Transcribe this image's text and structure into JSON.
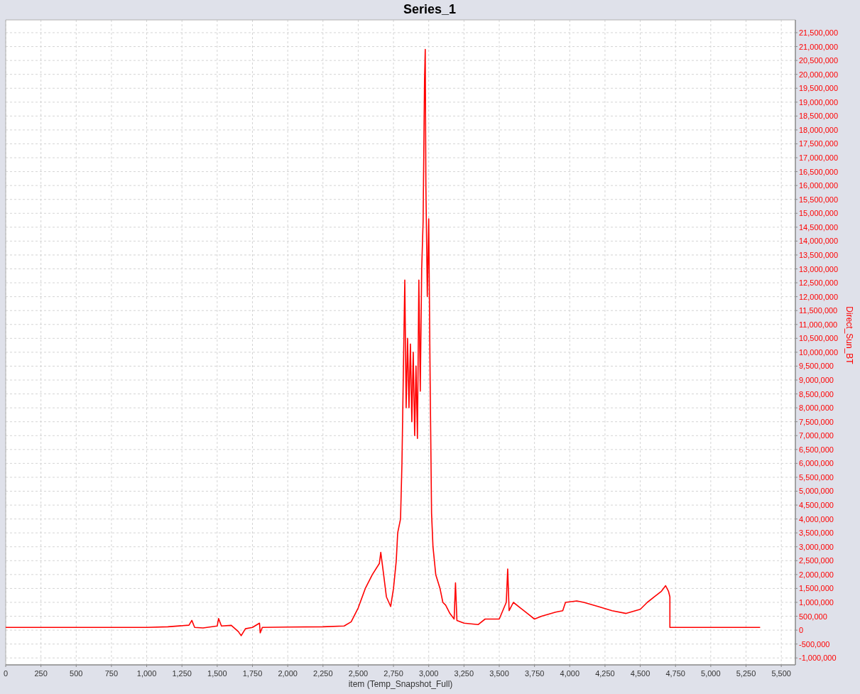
{
  "chart": {
    "chart_data": {
      "type": "line",
      "title": "Series_1",
      "xlabel": "item (Temp_Snapshot_Full)",
      "ylabel": "Direct_Sun_BT",
      "x": [
        0,
        500,
        1000,
        1150,
        1300,
        1320,
        1340,
        1400,
        1500,
        1510,
        1530,
        1600,
        1650,
        1670,
        1700,
        1750,
        1800,
        1805,
        1820,
        2000,
        2250,
        2400,
        2450,
        2500,
        2550,
        2600,
        2650,
        2660,
        2680,
        2700,
        2730,
        2750,
        2770,
        2780,
        2800,
        2810,
        2830,
        2840,
        2850,
        2860,
        2870,
        2880,
        2890,
        2900,
        2910,
        2920,
        2930,
        2940,
        2950,
        2960,
        2970,
        2975,
        2980,
        2990,
        3000,
        3010,
        3020,
        3030,
        3050,
        3080,
        3100,
        3120,
        3150,
        3180,
        3190,
        3200,
        3250,
        3350,
        3400,
        3500,
        3550,
        3560,
        3570,
        3600,
        3650,
        3700,
        3750,
        3800,
        3900,
        3950,
        3970,
        4050,
        4100,
        4200,
        4300,
        4400,
        4500,
        4550,
        4600,
        4650,
        4680,
        4700,
        4710,
        4710,
        5350
      ],
      "grid": true,
      "series": [
        {
          "color": "#ff0000",
          "values": [
            100000,
            100000,
            100000,
            120000,
            180000,
            350000,
            100000,
            80000,
            150000,
            420000,
            150000,
            170000,
            -50000,
            -200000,
            50000,
            100000,
            250000,
            -100000,
            100000,
            110000,
            120000,
            150000,
            300000,
            800000,
            1500000,
            2000000,
            2400000,
            2800000,
            2000000,
            1200000,
            850000,
            1500000,
            2500000,
            3500000,
            4000000,
            6000000,
            12600000,
            8000000,
            10500000,
            8000000,
            10300000,
            7500000,
            10000000,
            7000000,
            9500000,
            6900000,
            12600000,
            8600000,
            13000000,
            14700000,
            19800000,
            20900000,
            16000000,
            12000000,
            14800000,
            9000000,
            4200000,
            3000000,
            2000000,
            1500000,
            1000000,
            900000,
            600000,
            400000,
            1700000,
            350000,
            250000,
            200000,
            400000,
            400000,
            1000000,
            2200000,
            700000,
            1000000,
            800000,
            600000,
            400000,
            500000,
            650000,
            700000,
            1000000,
            1050000,
            1000000,
            850000,
            700000,
            600000,
            750000,
            1000000,
            1200000,
            1400000,
            1600000,
            1400000,
            1200000,
            100000,
            100000
          ]
        }
      ],
      "xlim": [
        0,
        5600
      ],
      "ylim": [
        -1250000,
        21960000
      ],
      "xticks": [
        {
          "value": 0,
          "label": "0"
        },
        {
          "value": 250,
          "label": "250"
        },
        {
          "value": 500,
          "label": "500"
        },
        {
          "value": 750,
          "label": "750"
        },
        {
          "value": 1000,
          "label": "1,000"
        },
        {
          "value": 1250,
          "label": "1,250"
        },
        {
          "value": 1500,
          "label": "1,500"
        },
        {
          "value": 1750,
          "label": "1,750"
        },
        {
          "value": 2000,
          "label": "2,000"
        },
        {
          "value": 2250,
          "label": "2,250"
        },
        {
          "value": 2500,
          "label": "2,500"
        },
        {
          "value": 2750,
          "label": "2,750"
        },
        {
          "value": 3000,
          "label": "3,000"
        },
        {
          "value": 3250,
          "label": "3,250"
        },
        {
          "value": 3500,
          "label": "3,500"
        },
        {
          "value": 3750,
          "label": "3,750"
        },
        {
          "value": 4000,
          "label": "4,000"
        },
        {
          "value": 4250,
          "label": "4,250"
        },
        {
          "value": 4500,
          "label": "4,500"
        },
        {
          "value": 4750,
          "label": "4,750"
        },
        {
          "value": 5000,
          "label": "5,000"
        },
        {
          "value": 5250,
          "label": "5,250"
        },
        {
          "value": 5500,
          "label": "5,500"
        }
      ],
      "yticks": [
        {
          "value": -1000000,
          "label": "-1,000,000"
        },
        {
          "value": -500000,
          "label": "-500,000"
        },
        {
          "value": 0,
          "label": "0"
        },
        {
          "value": 500000,
          "label": "500,000"
        },
        {
          "value": 1000000,
          "label": "1,000,000"
        },
        {
          "value": 1500000,
          "label": "1,500,000"
        },
        {
          "value": 2000000,
          "label": "2,000,000"
        },
        {
          "value": 2500000,
          "label": "2,500,000"
        },
        {
          "value": 3000000,
          "label": "3,000,000"
        },
        {
          "value": 3500000,
          "label": "3,500,000"
        },
        {
          "value": 4000000,
          "label": "4,000,000"
        },
        {
          "value": 4500000,
          "label": "4,500,000"
        },
        {
          "value": 5000000,
          "label": "5,000,000"
        },
        {
          "value": 5500000,
          "label": "5,500,000"
        },
        {
          "value": 6000000,
          "label": "6,000,000"
        },
        {
          "value": 6500000,
          "label": "6,500,000"
        },
        {
          "value": 7000000,
          "label": "7,000,000"
        },
        {
          "value": 7500000,
          "label": "7,500,000"
        },
        {
          "value": 8000000,
          "label": "8,000,000"
        },
        {
          "value": 8500000,
          "label": "8,500,000"
        },
        {
          "value": 9000000,
          "label": "9,000,000"
        },
        {
          "value": 9500000,
          "label": "9,500,000"
        },
        {
          "value": 10000000,
          "label": "10,000,000"
        },
        {
          "value": 10500000,
          "label": "10,500,000"
        },
        {
          "value": 11000000,
          "label": "11,000,000"
        },
        {
          "value": 11500000,
          "label": "11,500,000"
        },
        {
          "value": 12000000,
          "label": "12,000,000"
        },
        {
          "value": 12500000,
          "label": "12,500,000"
        },
        {
          "value": 13000000,
          "label": "13,000,000"
        },
        {
          "value": 13500000,
          "label": "13,500,000"
        },
        {
          "value": 14000000,
          "label": "14,000,000"
        },
        {
          "value": 14500000,
          "label": "14,500,000"
        },
        {
          "value": 15000000,
          "label": "15,000,000"
        },
        {
          "value": 15500000,
          "label": "15,500,000"
        },
        {
          "value": 16000000,
          "label": "16,000,000"
        },
        {
          "value": 16500000,
          "label": "16,500,000"
        },
        {
          "value": 17000000,
          "label": "17,000,000"
        },
        {
          "value": 17500000,
          "label": "17,500,000"
        },
        {
          "value": 18000000,
          "label": "18,000,000"
        },
        {
          "value": 18500000,
          "label": "18,500,000"
        },
        {
          "value": 19000000,
          "label": "19,000,000"
        },
        {
          "value": 19500000,
          "label": "19,500,000"
        },
        {
          "value": 20000000,
          "label": "20,000,000"
        },
        {
          "value": 20500000,
          "label": "20,500,000"
        },
        {
          "value": 21000000,
          "label": "21,000,000"
        },
        {
          "value": 21500000,
          "label": "21,500,000"
        }
      ]
    }
  }
}
